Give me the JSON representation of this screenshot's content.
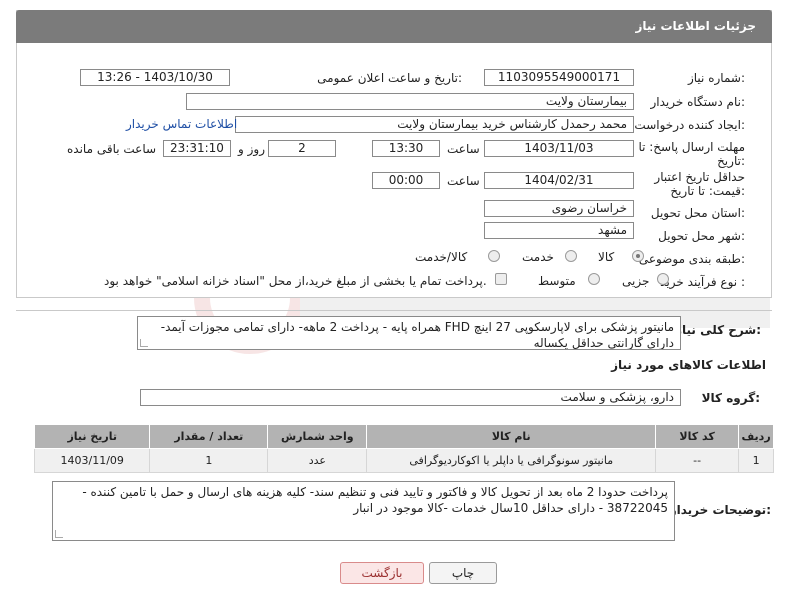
{
  "header": {
    "title": "جزئیات اطلاعات نیاز"
  },
  "form": {
    "need_number_label": "شماره نیاز:",
    "need_number": "1103095549000171",
    "announce_label": "تاریخ و ساعت اعلان عمومی:",
    "announce_value": "1403/10/30 - 13:26",
    "buyer_org_label": "نام دستگاه خریدار:",
    "buyer_org": "بیمارستان ولایت",
    "creator_label": "ایجاد کننده درخواست:",
    "creator": "محمد رحمدل کارشناس خرید بیمارستان ولایت",
    "contact_link": "اطلاعات تماس خریدار",
    "deadline_label": "مهلت ارسال پاسخ: تا تاریخ:",
    "deadline_date": "1403/11/03",
    "hour_label": "ساعت",
    "deadline_hour": "13:30",
    "days_value": "2",
    "days_label": "روز و",
    "remaining_value": "23:31:10",
    "remaining_label": "ساعت باقی مانده",
    "validity_label": "حداقل تاریخ اعتبار قیمت: تا تاریخ:",
    "validity_date": "1404/02/31",
    "validity_hour": "00:00",
    "province_label": "استان محل تحویل:",
    "province": "خراسان رضوی",
    "city_label": "شهر محل تحویل:",
    "city": "مشهد",
    "category_label": "طبقه بندی موضوعی:",
    "category_options": [
      "کالا",
      "خدمت",
      "کالا/خدمت"
    ],
    "process_label": "نوع فرآیند خرید :",
    "process_options": [
      "جزیی",
      "متوسط"
    ],
    "payment_note": "پرداخت تمام یا بخشی از مبلغ خرید،از محل \"اسناد خزانه اسلامی\" خواهد بود."
  },
  "description": {
    "label": "شرح کلی نیاز:",
    "text": "مانیتور پزشکی برای لاپارسکوپی 27 اینچ FHD همراه پایه -  پرداخت 2 ماهه- دارای تمامی مجوزات آیمد- دارای گارانتی حداقل یکساله"
  },
  "goods": {
    "section_title": "اطلاعات کالاهای مورد نیاز",
    "group_label": "گروه کالا:",
    "group_value": "دارو، پزشکی و سلامت",
    "columns": [
      "ردیف",
      "کد کالا",
      "نام کالا",
      "واحد شمارش",
      "تعداد / مقدار",
      "تاریخ نیاز"
    ],
    "rows": [
      [
        "1",
        "--",
        "مانیتور سونوگرافی یا داپلر یا اکوکاردیوگرافی",
        "عدد",
        "1",
        "1403/11/09"
      ]
    ]
  },
  "buyer_notes": {
    "label": "توضیحات خریدار:",
    "text": "پرداخت حدودا 2 ماه بعد از تحویل کالا و فاکتور و تایید فنی و تنظیم سند- کلیه هزینه های ارسال و حمل با تامین کننده - 38722045 - دارای حداقل 10سال خدمات -کالا موجود در انبار"
  },
  "buttons": {
    "print": "چاپ",
    "back": "بازگشت"
  },
  "colors": {
    "header_bg": "#7b7b7b",
    "link": "#1f4fa5",
    "table_header": "#b3b3b3"
  }
}
